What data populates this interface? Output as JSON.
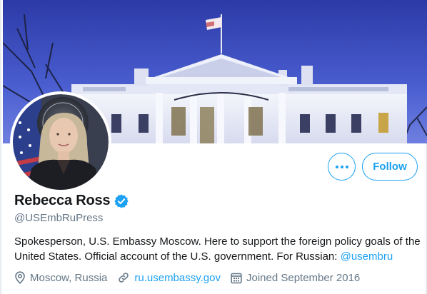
{
  "profile": {
    "display_name": "Rebecca Ross",
    "verified": true,
    "handle": "@USEmbRuPress",
    "bio_text": "Spokesperson, U.S. Embassy Moscow. Here to support the foreign policy goals of the United States. Official account of the U.S. government. For Russian: ",
    "bio_mention": "@usembru",
    "location": "Moscow, Russia",
    "website": "ru.usembassy.gov",
    "joined": "Joined September 2016"
  },
  "actions": {
    "follow_label": "Follow",
    "more_icon": "more-horizontal-icon"
  },
  "icons": {
    "location": "map-pin-icon",
    "website": "link-icon",
    "joined": "calendar-icon",
    "verified": "verified-badge-icon"
  },
  "colors": {
    "accent": "#1da1f2",
    "secondary_text": "#657786",
    "primary_text": "#14171a"
  }
}
